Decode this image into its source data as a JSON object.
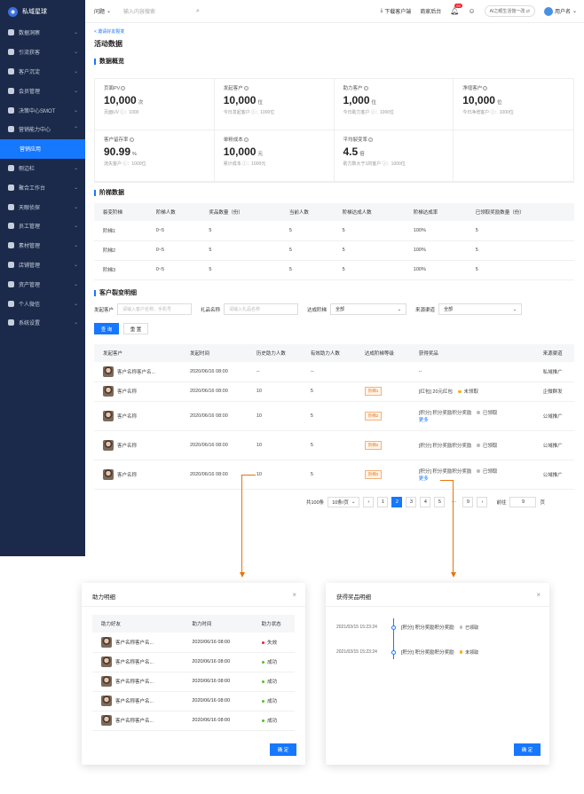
{
  "app": {
    "name": "私域星球"
  },
  "sidebar": {
    "items": [
      {
        "label": "数据洞察"
      },
      {
        "label": "引流获客"
      },
      {
        "label": "客户沉淀"
      },
      {
        "label": "会员管理"
      },
      {
        "label": "决策中心SMOT"
      },
      {
        "label": "营销能力中心"
      },
      {
        "label": "营销应用"
      },
      {
        "label": "侧边栏"
      },
      {
        "label": "聚合工作台"
      },
      {
        "label": "天眼侦探"
      },
      {
        "label": "员工管理"
      },
      {
        "label": "素材管理"
      },
      {
        "label": "店铺管理"
      },
      {
        "label": "资产管理"
      },
      {
        "label": "个人微信"
      },
      {
        "label": "系统设置"
      }
    ]
  },
  "header": {
    "question": "问题",
    "search_placeholder": "输入内容搜索",
    "download": "下载客户端",
    "merchant": "商家后台",
    "badge_count": "99",
    "ai_text": "AI之眼生活馆一改",
    "username": "用户名"
  },
  "page": {
    "back": "< 邀请好友裂变",
    "title": "活动数据"
  },
  "overview": {
    "title": "数据概览",
    "stats": [
      {
        "label": "页面PV",
        "value": "10,000",
        "unit": "次",
        "sub": "页面UV ⓘ：1000"
      },
      {
        "label": "发起客户",
        "value": "10,000",
        "unit": "位",
        "sub": "今日发起客户 ⓘ：1000位"
      },
      {
        "label": "助力客户",
        "value": "1,000",
        "unit": "位",
        "sub": "今日助力客户 ⓘ：1000位"
      },
      {
        "label": "净增客户",
        "value": "10,000",
        "unit": "位",
        "sub": "今日净增客户 ⓘ：1000位"
      },
      {
        "label": "客户留存率",
        "value": "90.99",
        "unit": "%",
        "sub": "流失客户 ⓘ：1000位"
      },
      {
        "label": "单粉成本",
        "value": "10,000",
        "unit": "元",
        "sub": "累计成本 ⓘ：1000元"
      },
      {
        "label": "平均裂变率",
        "value": "4.5",
        "unit": "倍",
        "sub": "助力数大于1的客户 ⓘ：1000位"
      }
    ]
  },
  "stages": {
    "title": "阶梯数据",
    "columns": [
      "裂变阶梯",
      "阶梯人数",
      "奖品数量（份）",
      "当前人数",
      "阶梯达成人数",
      "阶梯达成率",
      "已领取奖励数量（份）"
    ],
    "rows": [
      [
        "阶梯1",
        "0~5",
        "5",
        "5",
        "5",
        "100%",
        "5"
      ],
      [
        "阶梯2",
        "0~5",
        "5",
        "5",
        "5",
        "100%",
        "5"
      ],
      [
        "阶梯3",
        "0~5",
        "5",
        "5",
        "5",
        "100%",
        "5"
      ]
    ]
  },
  "detail": {
    "title": "客户裂变明细",
    "filters": {
      "initiator_label": "发起客户",
      "initiator_placeholder": "请输入客户名称、手机号",
      "gift_label": "礼品名称",
      "gift_placeholder": "请输入礼品名称",
      "stage_label": "达成阶梯",
      "stage_value": "全部",
      "channel_label": "来源渠道",
      "channel_value": "全部"
    },
    "query_button": "查 询",
    "reset_button": "重 置",
    "columns": [
      "发起客户",
      "发起时间",
      "历史助力人数",
      "有效助力人数",
      "达成阶梯等级",
      "获得奖品",
      "来源渠道"
    ],
    "rows": [
      {
        "name": "客户名称客户名...",
        "time": "2020/06/16 08:00",
        "history": "--",
        "valid": "--",
        "level": "",
        "prize": "--",
        "status": "",
        "more": "",
        "channel": "私域推广"
      },
      {
        "name": "客户名称",
        "time": "2020/06/16 08:00",
        "history": "10",
        "valid": "5",
        "level": "阶梯1",
        "prize": "[红包] 20元红包",
        "status": "未领取",
        "more": "",
        "channel": "企微群发"
      },
      {
        "name": "客户名称",
        "time": "2020/06/16 08:00",
        "history": "10",
        "valid": "5",
        "level": "阶梯2",
        "prize": "[积分] 积分奖励积分奖励",
        "status": "已领取",
        "more": "更多",
        "channel": "公域推广"
      },
      {
        "name": "客户名称",
        "time": "2020/06/16 08:00",
        "history": "10",
        "valid": "5",
        "level": "阶梯2",
        "prize": "[积分] 积分奖励积分奖励",
        "status": "已领取",
        "more": "",
        "channel": "公域推广"
      },
      {
        "name": "客户名称",
        "time": "2020/06/16 08:00",
        "history": "10",
        "valid": "5",
        "level": "阶梯3",
        "prize": "[积分] 积分奖励积分奖励",
        "status": "已领取",
        "more": "更多",
        "channel": "公域推广"
      }
    ],
    "pager": {
      "total": "共100条",
      "size": "10条/页",
      "pages": [
        "1",
        "2",
        "3",
        "4",
        "5",
        "···",
        "9"
      ],
      "goto": "前往",
      "goto_value": "9",
      "page_unit": "页"
    }
  },
  "assist_modal": {
    "title": "助力明细",
    "columns": [
      "助力好友",
      "助力时间",
      "助力状态"
    ],
    "rows": [
      {
        "name": "客户名称客户名...",
        "time": "2020/06/16 08:00",
        "status": "失效"
      },
      {
        "name": "客户名称客户名...",
        "time": "2020/06/16 08:00",
        "status": "成功"
      },
      {
        "name": "客户名称客户名...",
        "time": "2020/06/16 08:00",
        "status": "成功"
      },
      {
        "name": "客户名称客户名...",
        "time": "2020/06/16 08:00",
        "status": "成功"
      },
      {
        "name": "客户名称客户名...",
        "time": "2020/06/16 08:00",
        "status": "成功"
      }
    ],
    "ok": "确 定"
  },
  "prize_modal": {
    "title": "获得奖品明细",
    "items": [
      {
        "time": "2021/03/15 15:23:24",
        "text": "[积分] 积分奖励积分奖励",
        "status": "已领取"
      },
      {
        "time": "2021/03/15 15:23:24",
        "text": "[积分] 积分奖励积分奖励",
        "status": "未领取"
      }
    ],
    "ok": "确 定"
  },
  "colors": {
    "primary": "#1677ff",
    "sidebar": "#1b2a4a",
    "accent_orange": "#e8740c",
    "success": "#52c41a",
    "danger": "#f5222d",
    "pending": "#faad14",
    "muted": "#bbbbbb"
  }
}
